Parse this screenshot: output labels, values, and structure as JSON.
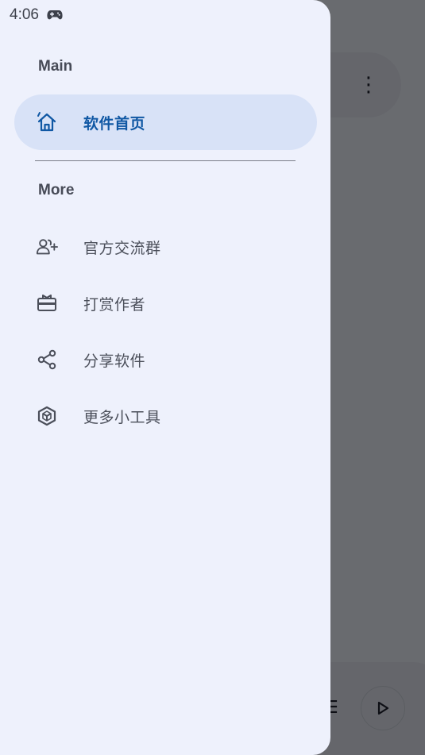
{
  "status_bar": {
    "time": "4:06",
    "icon": "gamepad-icon"
  },
  "drawer": {
    "sections": [
      {
        "label": "Main",
        "items": [
          {
            "label": "软件首页",
            "icon": "home-icon",
            "active": true
          }
        ]
      },
      {
        "label": "More",
        "items": [
          {
            "label": "官方交流群",
            "icon": "group-add-icon"
          },
          {
            "label": "打赏作者",
            "icon": "gift-card-icon"
          },
          {
            "label": "分享软件",
            "icon": "share-icon"
          },
          {
            "label": "更多小工具",
            "icon": "cube-icon"
          }
        ]
      }
    ]
  },
  "background": {
    "overflow_icon": "more-vert-icon",
    "list_icon": "list-icon",
    "play_icon": "play-icon"
  },
  "colors": {
    "drawer_bg": "#eef1fc",
    "active_bg": "#d8e2f7",
    "accent": "#1058a4",
    "text": "#4b4f5a",
    "scrim": "rgba(0,0,0,0.55)"
  }
}
